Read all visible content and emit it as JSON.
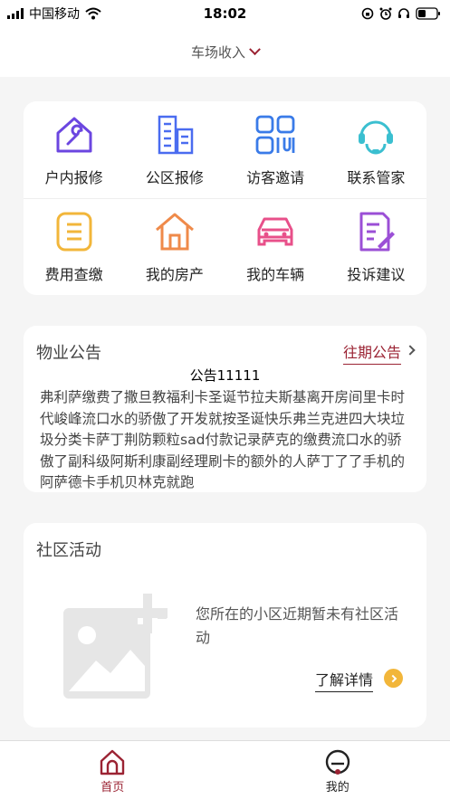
{
  "status_bar": {
    "carrier": "中国移动",
    "time": "18:02"
  },
  "header": {
    "title": "车场收入"
  },
  "services": [
    {
      "label": "户内报修",
      "icon": "home-repair-icon",
      "color": "#6b46e0"
    },
    {
      "label": "公区报修",
      "icon": "building-icon",
      "color": "#4a6cf0"
    },
    {
      "label": "访客邀请",
      "icon": "qr-grid-icon",
      "color": "#3a7be8"
    },
    {
      "label": "联系管家",
      "icon": "headset-icon",
      "color": "#3bbfd0"
    },
    {
      "label": "费用查缴",
      "icon": "bill-icon",
      "color": "#f2b63a"
    },
    {
      "label": "我的房产",
      "icon": "house-icon",
      "color": "#ef8a4a"
    },
    {
      "label": "我的车辆",
      "icon": "car-icon",
      "color": "#e8508a"
    },
    {
      "label": "投诉建议",
      "icon": "complaint-icon",
      "color": "#9b4fd6"
    }
  ],
  "notice": {
    "title": "物业公告",
    "more": "往期公告",
    "headline": "公告11111",
    "body": "弗利萨缴费了撒旦教福利卡圣诞节拉夫斯基离开房间里卡时代峻峰流口水的骄傲了开发就按圣诞快乐弗兰克进四大块垃圾分类卡萨丁荆防颗粒sad付款记录萨克的缴费流口水的骄傲了副科级阿斯利康副经理刷卡的额外的人萨丁了了手机的阿萨德卡手机贝林克就跑"
  },
  "activity": {
    "title": "社区活动",
    "empty": "您所在的小区近期暂未有社区活动",
    "detail": "了解详情"
  },
  "tabbar": {
    "home": "首页",
    "mine": "我的"
  },
  "colors": {
    "accent": "#9b2333",
    "detail_badge": "#f2b63a"
  }
}
